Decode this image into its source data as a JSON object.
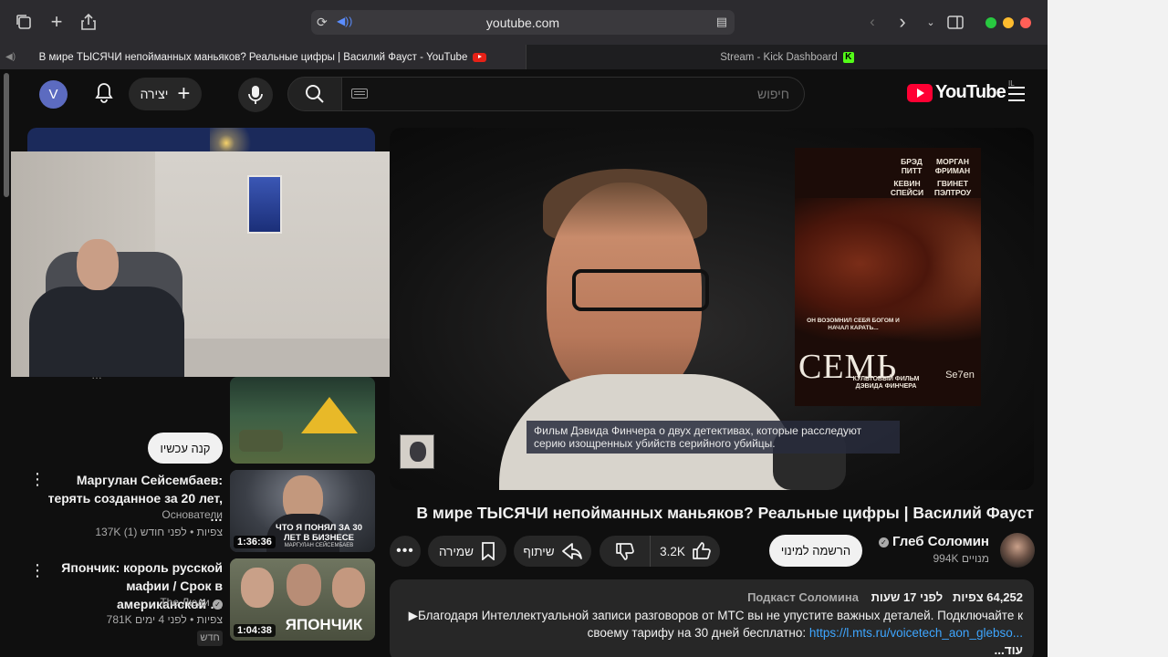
{
  "browser": {
    "url": "youtube.com",
    "tabs": [
      {
        "title": "В мире ТЫСЯЧИ непойманных маньяков? Реальные цифры | Василий Фауст - YouTube",
        "active": true
      },
      {
        "title": "Stream - Kick Dashboard",
        "active": false
      }
    ]
  },
  "header": {
    "avatar_letter": "V",
    "create_label": "יצירה",
    "search_placeholder": "חיפוש",
    "logo_text": "YouTube",
    "logo_country": "IL"
  },
  "sidebar": {
    "buy_button": "קנה עכשיו",
    "videos": [
      {
        "title_line1": "Маргулан Сейсембаев:",
        "title_line2": "терять созданное за 20 лет, …",
        "channel": "Основатели",
        "meta": "137K צפיות • לפני חודש (1)",
        "duration": "1:36:36",
        "thumb_text": "ЧТО Я ПОНЯЛ ЗА 30 ЛЕТ В БИЗНЕСЕ",
        "thumb_sub": "МАРГУЛАН СЕЙСЕМБАЕВ"
      },
      {
        "title_line1": "Япончик: король русской",
        "title_line2": "мафии / Срок в американской …",
        "channel": "The Люди",
        "meta": "781K צפיות • לפני 4 ימים",
        "badge": "חדש",
        "duration": "1:04:38",
        "thumb_text": "ЯПОНЧИК"
      }
    ]
  },
  "player": {
    "caption": "Фильм Дэвида Финчера о двух детективах, которые расследуют серию изощренных убийств серийного убийцы.",
    "poster": {
      "actor1": "БРЭД ПИТТ",
      "actor2": "МОРГАН ФРИМАН",
      "actor3": "КЕВИН СПЕЙСИ",
      "actor4": "ГВИНЕТ ПЭЛТРОУ",
      "tagline": "ОН ВОЗОМНИЛ СЕБЯ БОГОМ И НАЧАЛ КАРАТЬ...",
      "title": "СЕМЬ",
      "title_en": "Se7en",
      "footer": "КУЛЬТОВЫЙ ФИЛЬМ ДЭВИДА ФИНЧЕРА"
    }
  },
  "video": {
    "title": "В мире ТЫСЯЧИ непойманных маньяков? Реальные цифры | Василий Фауст",
    "channel_name": "Глеб Соломин",
    "subscribers": "994K מנויים",
    "subscribe_label": "הרשמה למינוי",
    "likes": "3.2K",
    "share_label": "שיתוף",
    "save_label": "שמירה",
    "more_label": "•••"
  },
  "description": {
    "views": "64,252 צפיות",
    "age": "לפני 17 שעות",
    "tag": "Подкаст Соломина",
    "line1": "▶Благодаря Интеллектуальной записи разговоров от МТС вы не упустите важных деталей. Подключайте к",
    "line2_text": "своему тарифу на 30 дней бесплатно: ",
    "line2_link": "https://l.mts.ru/voicetech_aon_glebso...",
    "more": "...עוד"
  }
}
